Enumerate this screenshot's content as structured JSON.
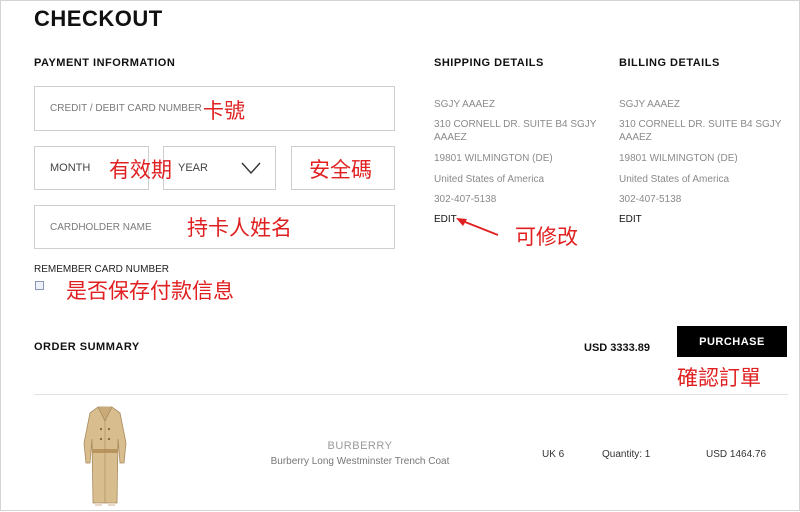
{
  "page": {
    "title": "CHECKOUT"
  },
  "payment": {
    "heading": "PAYMENT INFORMATION",
    "card_number_placeholder": "CREDIT / DEBIT CARD NUMBER",
    "month_label": "MONTH",
    "year_label": "YEAR",
    "cardholder_placeholder": "CARDHOLDER NAME",
    "remember_label": "REMEMBER CARD NUMBER"
  },
  "shipping": {
    "heading": "SHIPPING DETAILS",
    "name": "SGJY AAAEZ",
    "street_line1": "310 CORNELL DR. SUITE B4 SGJY",
    "street_line2": "AAAEZ",
    "city": "19801 WILMINGTON (DE)",
    "country": "United States of America",
    "phone": "302-407-5138",
    "edit_label": "EDIT"
  },
  "billing": {
    "heading": "BILLING DETAILS",
    "name": "SGJY AAAEZ",
    "street_line1": "310 CORNELL DR. SUITE B4 SGJY",
    "street_line2": "AAAEZ",
    "city": "19801 WILMINGTON (DE)",
    "country": "United States of America",
    "phone": "302-407-5138",
    "edit_label": "EDIT"
  },
  "order": {
    "heading": "ORDER SUMMARY",
    "total": "USD 3333.89",
    "purchase_label": "PURCHASE",
    "items": [
      {
        "brand": "BURBERRY",
        "name": "Burberry Long Westminster Trench Coat",
        "size": "UK 6",
        "quantity": "Quantity: 1",
        "price": "USD 1464.76"
      }
    ]
  },
  "annotations": {
    "card_number": "卡號",
    "expiry": "有效期",
    "security_code": "安全碼",
    "cardholder": "持卡人姓名",
    "remember": "是否保存付款信息",
    "editable": "可修改",
    "confirm": "確認訂單"
  },
  "colors": {
    "annotation": "#e02020",
    "purchase_bg": "#000000",
    "border": "#cfcfcf"
  }
}
